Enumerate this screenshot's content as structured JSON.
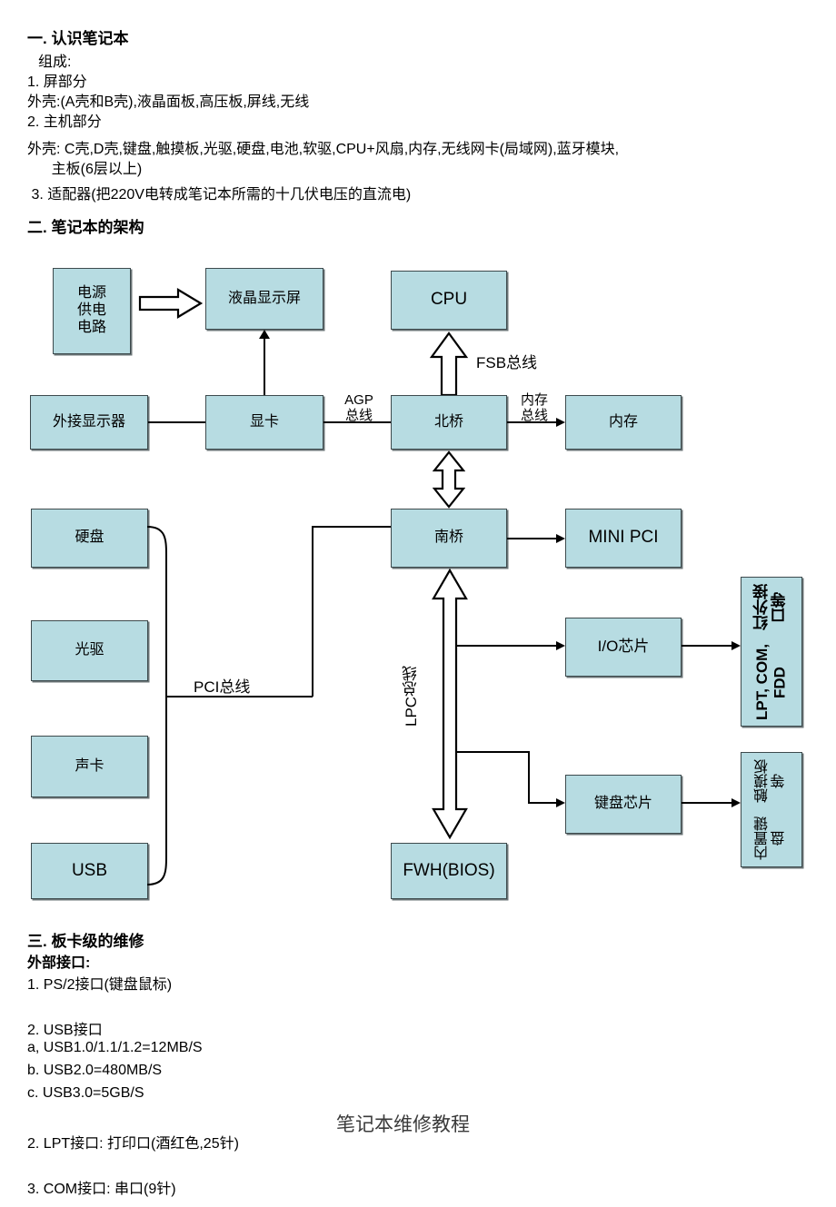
{
  "sections": {
    "s1_title": "一. 认识笔记本",
    "s1_lines": [
      "组成:",
      "1. 屏部分",
      "外壳:(A壳和B壳),液晶面板,高压板,屏线,无线",
      "2. 主机部分",
      "外壳: C壳,D壳,键盘,触摸板,光驱,硬盘,电池,软驱,CPU+风扇,内存,无线网卡(局域网),蓝牙模块,",
      "      主板(6层以上)",
      " 3. 适配器(把220V电转成笔记本所需的十几伏电压的直流电)"
    ],
    "s2_title": "二. 笔记本的架构",
    "s3_title": "三. 板卡级的维修",
    "s3_sub": "外部接口:",
    "s3_lines": [
      "1. PS/2接口(键盘鼠标)",
      "2. USB接口",
      "a, USB1.0/1.1/1.2=12MB/S",
      "b. USB2.0=480MB/S",
      "c. USB3.0=5GB/S",
      "2. LPT接口: 打印口(酒红色,25针)",
      "3. COM接口: 串口(9针)"
    ],
    "watermark": "笔记本维修教程"
  },
  "diagram": {
    "title": "二. 笔记本的架构",
    "box_fill": "#b7dce2",
    "box_border": "#3d4a4d",
    "nodes": {
      "power": "电源\n供电\n电路",
      "power_lines": [
        "电源",
        "供电",
        "电路"
      ],
      "lcd": "液晶显示屏",
      "cpu": "CPU",
      "ext_monitor": "外接显示器",
      "gpu": "显卡",
      "northbridge": "北桥",
      "memory": "内存",
      "hdd": "硬盘",
      "odd": "光驱",
      "soundcard": "声卡",
      "usb": "USB",
      "southbridge": "南桥",
      "minipci": "MINI PCI",
      "io_chip": "I/O芯片",
      "kbd_chip": "键盘芯片",
      "fwh": "FWH(BIOS)",
      "lpt_group": [
        "LPT, COM, FDD",
        "红外接口等"
      ],
      "kbd_group": [
        "内置键盘",
        "触摸板等"
      ]
    },
    "bus_labels": {
      "agp": [
        "AGP",
        "总线"
      ],
      "fsb": "FSB总线",
      "mem": [
        "内存",
        "总线"
      ],
      "pci": "PCI总线",
      "lpc": "LPC总线"
    }
  }
}
